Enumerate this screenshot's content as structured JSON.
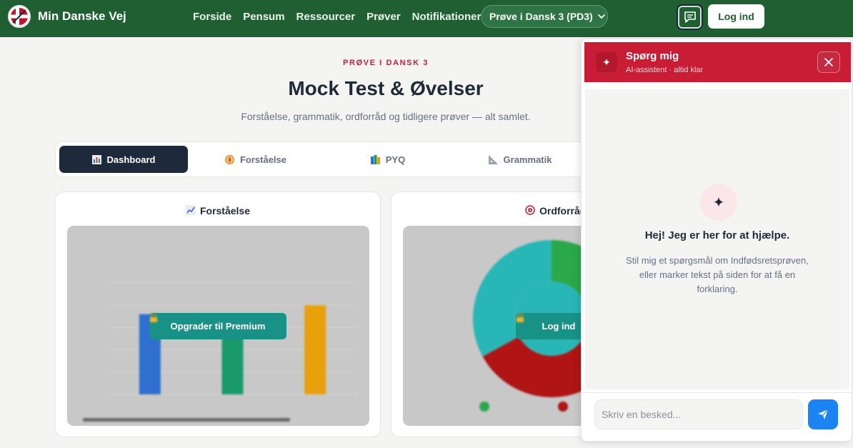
{
  "navbar": {
    "brand_name": "Min Danske Vej",
    "links": [
      "Forside",
      "Pensum",
      "Ressourcer",
      "Prøver",
      "Notifikationer"
    ],
    "selected_test": "Prøve i Dansk 3 (PD3)",
    "login_label": "Log ind"
  },
  "hero": {
    "eyebrow": "PRØVE I DANSK 3",
    "title": "Mock Test & Øvelser",
    "subtitle": "Forståelse, grammatik, ordforråd og tidligere prøver — alt samlet."
  },
  "tabs": [
    {
      "label": "Dashboard",
      "icon": "bar-chart-icon"
    },
    {
      "label": "Forståelse",
      "icon": "compass-icon"
    },
    {
      "label": "PYQ",
      "icon": "books-icon"
    },
    {
      "label": "Grammatik",
      "icon": "ruler-icon"
    }
  ],
  "cards": {
    "comprehension": {
      "title": "Forståelse",
      "overlay_label": "Opgrader til Premium"
    },
    "vocabulary": {
      "title": "Ordforråd",
      "overlay_label": "Log ind"
    }
  },
  "chat": {
    "title": "Spørg mig",
    "subtitle": "AI-assistent · altid klar",
    "greeting_title": "Hej! Jeg er her for at hjælpe.",
    "greeting_text": "Stil mig et spørgsmål om Indfødsretsprøven, eller marker tekst på siden for at få en forklaring.",
    "input_placeholder": "Skriv en besked..."
  },
  "chart_data": [
    {
      "type": "bar",
      "title": "",
      "categories": [
        "",
        "",
        ""
      ],
      "values": [
        72,
        70,
        80
      ],
      "ylim": [
        0,
        100
      ],
      "yticks": [
        0,
        20,
        40,
        60,
        80,
        100
      ],
      "colors": [
        "#2f6fd0",
        "#1a9a6a",
        "#e8a00b"
      ]
    },
    {
      "type": "pie",
      "labels": [
        "",
        "",
        ""
      ],
      "values": [
        33,
        34,
        33
      ],
      "colors": [
        "#2aa84a",
        "#b01414",
        "#29b6b6"
      ]
    }
  ],
  "colors": {
    "brand_green": "#1f5f32",
    "accent_red": "#c91c35",
    "teal": "#189286",
    "send_blue": "#1c83f2"
  }
}
